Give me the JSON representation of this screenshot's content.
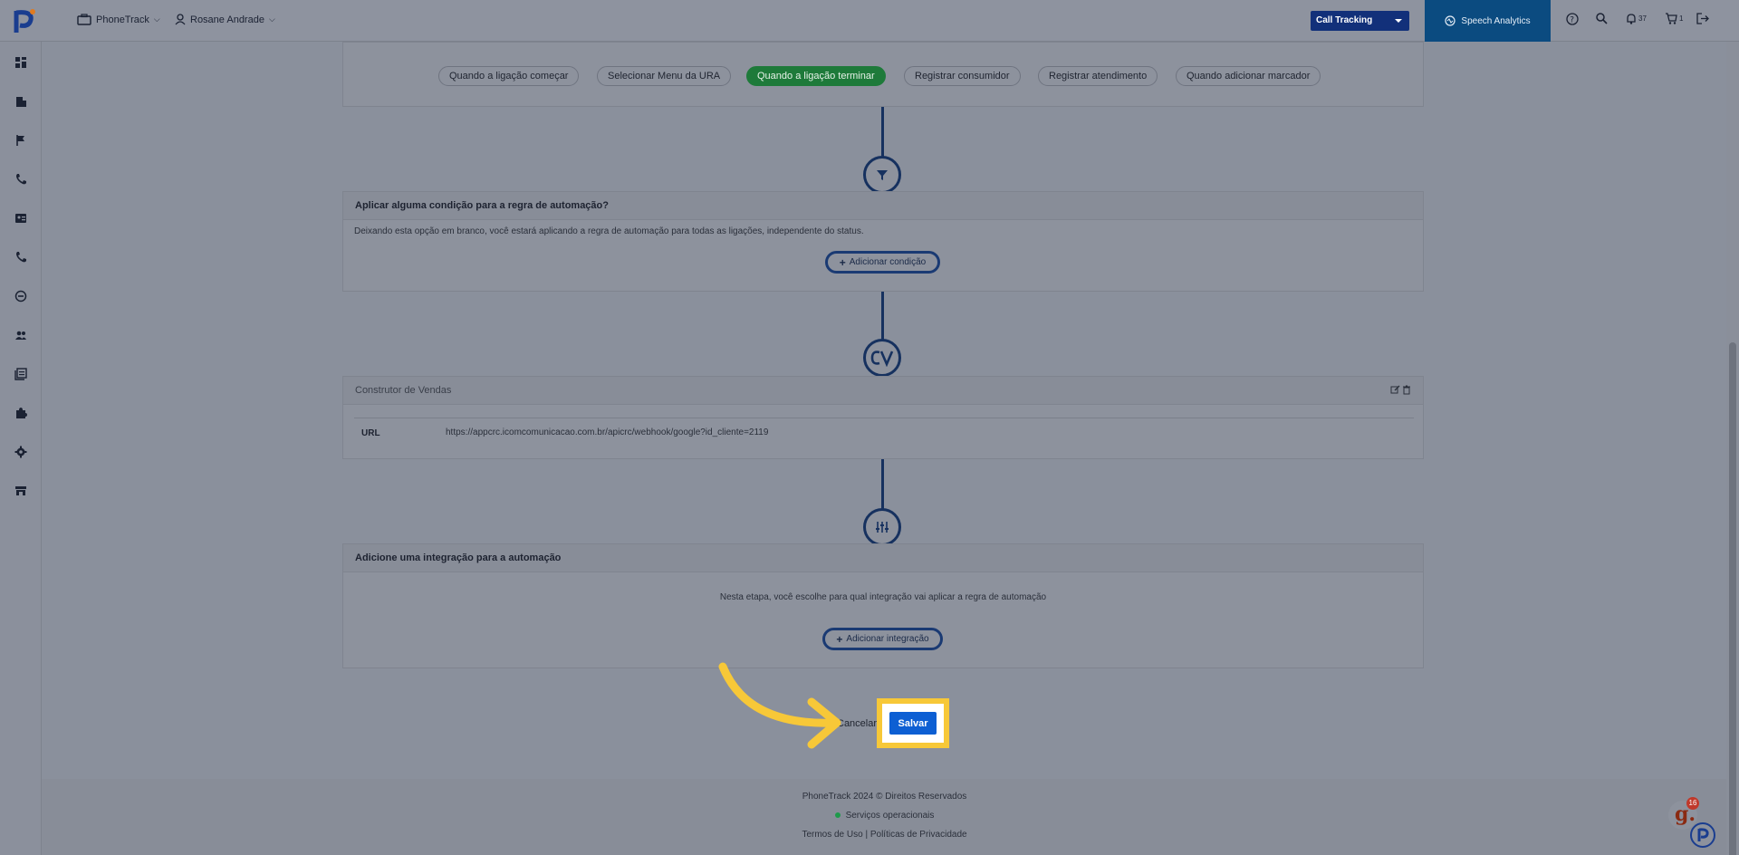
{
  "topbar": {
    "account": "PhoneTrack",
    "user": "Rosane Andrade",
    "product_select": "Call Tracking",
    "speech_analytics": "Speech Analytics",
    "notifications_count": "37",
    "cart_count": "1"
  },
  "sidebar": {
    "icons": [
      "dashboard-icon",
      "building-icon",
      "flag-icon",
      "phone-icon",
      "contact-card-icon",
      "phone-outgoing-icon",
      "minus-circle-icon",
      "users-icon",
      "reports-icon",
      "puzzle-icon",
      "settings-icon",
      "store-icon"
    ]
  },
  "triggers": {
    "items": [
      {
        "label": "Quando a ligação começar",
        "active": false
      },
      {
        "label": "Selecionar Menu da URA",
        "active": false
      },
      {
        "label": "Quando a ligação terminar",
        "active": true
      },
      {
        "label": "Registrar consumidor",
        "active": false
      },
      {
        "label": "Registrar atendimento",
        "active": false
      },
      {
        "label": "Quando adicionar marcador",
        "active": false
      }
    ]
  },
  "condition": {
    "title": "Aplicar alguma condição para a regra de automação?",
    "description": "Deixando esta opção em branco, você estará aplicando a regra de automação para todas as ligações, independente do status.",
    "add_button": "Adicionar condição"
  },
  "action": {
    "title": "Construtor de Vendas",
    "url_label": "URL",
    "url_value": "https://appcrc.icomcomunicacao.com.br/apicrc/webhook/google?id_cliente=2119"
  },
  "integration": {
    "title": "Adicione uma integração para a automação",
    "description": "Nesta etapa, você escolhe para qual integração vai aplicar a regra de automação",
    "add_button": "Adicionar integração"
  },
  "form_actions": {
    "cancel": "Cancelar",
    "save": "Salvar"
  },
  "footer": {
    "copyright": "PhoneTrack 2024 © Direitos Reservados",
    "status": "Serviços operacionais",
    "links": "Termos de Uso | Políticas de Privacidade"
  },
  "chat_badge": "16",
  "colors": {
    "accent": "#0d5fd3",
    "active_trigger": "#1e7a3a",
    "highlight": "#f7c838",
    "navy": "#16315f",
    "status_ok": "#1e9a4a"
  }
}
